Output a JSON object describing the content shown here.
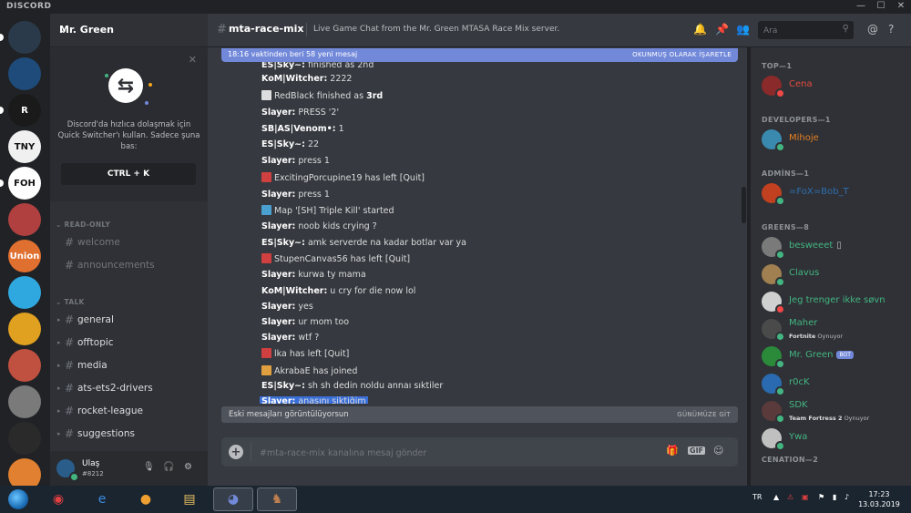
{
  "app": {
    "brand": "DISCORD"
  },
  "window_controls": {
    "minimize": "—",
    "maximize": "☐",
    "close": "✕"
  },
  "guild": {
    "name": "Mr. Green"
  },
  "server_icons": [
    {
      "label": "",
      "color": "#2a3a4a"
    },
    {
      "label": "",
      "color": "#1e4b7a"
    },
    {
      "label": "R",
      "color": "#1a1a1a"
    },
    {
      "label": "TNY",
      "color": "#f0f0f0"
    },
    {
      "label": "FOH",
      "color": "#ffffff"
    },
    {
      "label": "",
      "color": "#b04040"
    },
    {
      "label": "Union",
      "color": "#e07030"
    },
    {
      "label": "",
      "color": "#2fa8e0"
    },
    {
      "label": "",
      "color": "#e0a020"
    },
    {
      "label": "",
      "color": "#c05040"
    },
    {
      "label": "",
      "color": "#7a7a7a"
    },
    {
      "label": "",
      "color": "#2a2a2a"
    },
    {
      "label": "",
      "color": "#e08030"
    }
  ],
  "quick_switcher": {
    "text": "Discord'da hızlıca dolaşmak için Quick Switcher'ı kullan. Sadece şuna bas:",
    "shortcut": "CTRL + K"
  },
  "categories": {
    "readonly": "READ-ONLY",
    "talk": "TALK"
  },
  "channels_readonly": [
    {
      "name": "welcome"
    },
    {
      "name": "announcements"
    }
  ],
  "channels_talk": [
    {
      "name": "general"
    },
    {
      "name": "offtopic"
    },
    {
      "name": "media"
    },
    {
      "name": "ats-ets2-drivers"
    },
    {
      "name": "rocket-league"
    },
    {
      "name": "suggestions"
    }
  ],
  "current_user": {
    "name": "Ulaş",
    "tag": "#8212"
  },
  "channel": {
    "name": "mta-race-mix",
    "topic": "Live Game Chat from the Mr. Green MTASA Race Mix server."
  },
  "search": {
    "placeholder": "Ara"
  },
  "new_messages": {
    "text": "18:16 vaktinden beri 58 yeni mesaj",
    "action": "OKUNMUŞ OLARAK İŞARETLE"
  },
  "messages": [
    {
      "author": "ES|Sky~:",
      "text": "finished as 2nd",
      "icon": ""
    },
    {
      "author": "KoM|Witcher:",
      "text": "2222",
      "icon": ""
    },
    {
      "author": "",
      "text": "RedBlack finished as ",
      "bold": "3rd",
      "icon": "flag"
    },
    {
      "author": "Slayer:",
      "text": "PRESS '2'",
      "icon": ""
    },
    {
      "author": "SB|AS|Venom•:",
      "text": "1",
      "icon": ""
    },
    {
      "author": "ES|Sky~:",
      "text": "22",
      "icon": ""
    },
    {
      "author": "Slayer:",
      "text": "press 1",
      "icon": ""
    },
    {
      "author": "",
      "text": "ExcitingPorcupine19 has left [Quit]",
      "icon": "left"
    },
    {
      "author": "Slayer:",
      "text": "press 1",
      "icon": ""
    },
    {
      "author": "",
      "text": "Map '[SH] Triple Kill' started",
      "icon": "map"
    },
    {
      "author": "Slayer:",
      "text": "noob kids  crying ?",
      "icon": ""
    },
    {
      "author": "ES|Sky~:",
      "text": "amk serverde na kadar botlar var ya",
      "icon": ""
    },
    {
      "author": "",
      "text": "StupenCanvas56 has left [Quit]",
      "icon": "left"
    },
    {
      "author": "Slayer:",
      "text": "kurwa ty mama",
      "icon": ""
    },
    {
      "author": "KoM|Witcher:",
      "text": "u cry for die now lol",
      "icon": ""
    },
    {
      "author": "Slayer:",
      "text": "yes",
      "icon": ""
    },
    {
      "author": "Slayer:",
      "text": "ur mom too",
      "icon": ""
    },
    {
      "author": "Slayer:",
      "text": "wtf ?",
      "icon": ""
    },
    {
      "author": "",
      "text": "lka has left [Quit]",
      "icon": "left"
    },
    {
      "author": "",
      "text": "AkrabaE has joined",
      "icon": "join"
    },
    {
      "author": "ES|Sky~:",
      "text": "sh sh dedin noldu annaı sıktiler",
      "icon": ""
    },
    {
      "author": "Slayer:",
      "text": "anasını siktiğim",
      "icon": "",
      "highlight": true
    }
  ],
  "old_messages": {
    "text": "Eski mesajları görüntülüyorsun",
    "action": "GÜNÜMÜZE GİT"
  },
  "composer": {
    "placeholder": "#mta-race-mix kanalına mesaj gönder"
  },
  "member_groups": [
    {
      "title": "TOP—1",
      "members": [
        {
          "name": "Cena",
          "color": "#e74c3c",
          "avatar": "#8a2a2a",
          "status": "#f04747"
        }
      ]
    },
    {
      "title": "DEVELOPERS—1",
      "members": [
        {
          "name": "Mihoje",
          "color": "#e67e22",
          "avatar": "#3a8ab0",
          "status": "#43b581"
        }
      ]
    },
    {
      "title": "ADMİNS—1",
      "members": [
        {
          "name": "=FoX=Bob_T",
          "color": "#2f6fb0",
          "avatar": "#c04020",
          "status": "#43b581"
        }
      ]
    },
    {
      "title": "GREENS—8",
      "members": [
        {
          "name": "besweeet",
          "color": "#43b581",
          "avatar": "#7a7a7a",
          "status": "#43b581",
          "extra": "▯"
        },
        {
          "name": "Clavus",
          "color": "#43b581",
          "avatar": "#a08050",
          "status": "#43b581"
        },
        {
          "name": "Jeg trenger ikke søvn",
          "color": "#43b581",
          "avatar": "#d0d0d0",
          "status": "#f04747"
        },
        {
          "name": "Maher",
          "color": "#43b581",
          "avatar": "#4a4a4a",
          "status": "#43b581",
          "activity_prefix": "",
          "activity": "Fortnite",
          "activity_suffix": " Oynuyor"
        },
        {
          "name": "Mr. Green",
          "color": "#43b581",
          "avatar": "#2a8a3a",
          "status": "#43b581",
          "badge": "BOT"
        },
        {
          "name": "r0cK",
          "color": "#43b581",
          "avatar": "#2a6ab0",
          "status": "#43b581"
        },
        {
          "name": "SDK",
          "color": "#43b581",
          "avatar": "#5a3a3a",
          "status": "#43b581",
          "activity": "Team Fortress 2",
          "activity_suffix": " Oynuyor"
        },
        {
          "name": "Ywa",
          "color": "#43b581",
          "avatar": "#c0c0c0",
          "status": "#43b581"
        }
      ]
    },
    {
      "title": "CENATION—2",
      "members": []
    }
  ],
  "taskbar": {
    "apps": [
      {
        "name": "chrome",
        "glyph": "◉"
      },
      {
        "name": "internet-explorer",
        "glyph": "e"
      },
      {
        "name": "media-player",
        "glyph": "●"
      },
      {
        "name": "file-explorer",
        "glyph": "▤"
      },
      {
        "name": "discord",
        "glyph": "◕"
      },
      {
        "name": "game",
        "glyph": "♞"
      }
    ],
    "lang": "TR",
    "time": "17:23",
    "date": "13.03.2019"
  },
  "colors": {
    "accent": "#7289da",
    "green": "#43b581",
    "dnd": "#f04747"
  }
}
